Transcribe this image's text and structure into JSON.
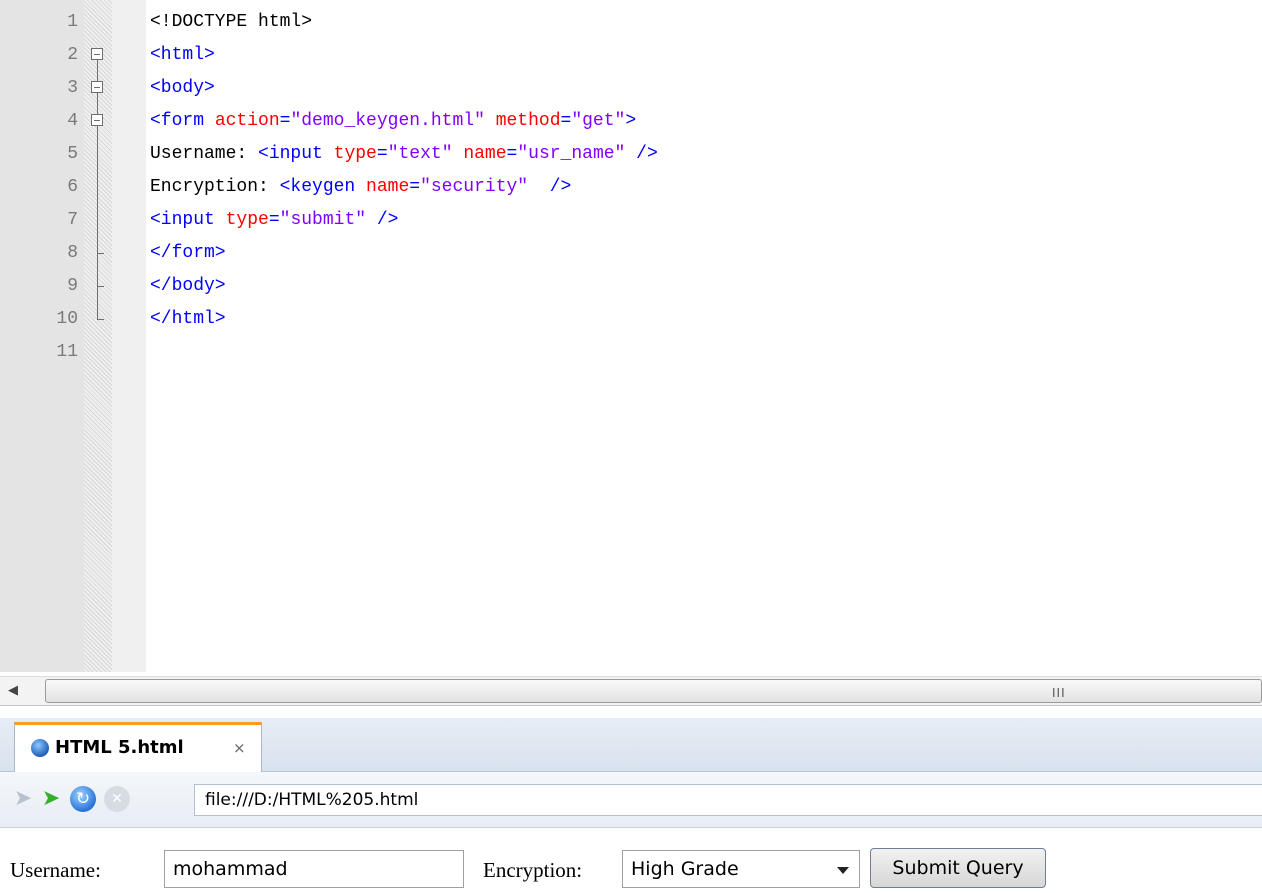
{
  "editor": {
    "lines": [
      {
        "num": "1",
        "parts": [
          {
            "t": "<!DOCTYPE html>",
            "c": "dark"
          }
        ]
      },
      {
        "num": "2",
        "parts": [
          {
            "t": "<html>",
            "c": "tag"
          }
        ]
      },
      {
        "num": "3",
        "parts": [
          {
            "t": "<body>",
            "c": "tag"
          }
        ]
      },
      {
        "num": "4",
        "parts": [
          {
            "t": "<form ",
            "c": "tag"
          },
          {
            "t": "action",
            "c": "attr"
          },
          {
            "t": "=",
            "c": "tag"
          },
          {
            "t": "\"demo_keygen.html\"",
            "c": "val"
          },
          {
            "t": " ",
            "c": "tag"
          },
          {
            "t": "method",
            "c": "attr"
          },
          {
            "t": "=",
            "c": "tag"
          },
          {
            "t": "\"get\"",
            "c": "val"
          },
          {
            "t": ">",
            "c": "tag"
          }
        ]
      },
      {
        "num": "5",
        "parts": [
          {
            "t": "Username: ",
            "c": "dark"
          },
          {
            "t": "<input ",
            "c": "tag"
          },
          {
            "t": "type",
            "c": "attr"
          },
          {
            "t": "=",
            "c": "tag"
          },
          {
            "t": "\"text\"",
            "c": "val"
          },
          {
            "t": " ",
            "c": "tag"
          },
          {
            "t": "name",
            "c": "attr"
          },
          {
            "t": "=",
            "c": "tag"
          },
          {
            "t": "\"usr_name\"",
            "c": "val"
          },
          {
            "t": " />",
            "c": "tag"
          }
        ]
      },
      {
        "num": "6",
        "parts": [
          {
            "t": "Encryption: ",
            "c": "dark"
          },
          {
            "t": "<keygen ",
            "c": "tag"
          },
          {
            "t": "name",
            "c": "attr"
          },
          {
            "t": "=",
            "c": "tag"
          },
          {
            "t": "\"security\"",
            "c": "val"
          },
          {
            "t": "  />",
            "c": "tag"
          }
        ]
      },
      {
        "num": "7",
        "parts": [
          {
            "t": "<input ",
            "c": "tag"
          },
          {
            "t": "type",
            "c": "attr"
          },
          {
            "t": "=",
            "c": "tag"
          },
          {
            "t": "\"submit\"",
            "c": "val"
          },
          {
            "t": " />",
            "c": "tag"
          }
        ]
      },
      {
        "num": "8",
        "parts": [
          {
            "t": "</form>",
            "c": "tag"
          }
        ]
      },
      {
        "num": "9",
        "parts": [
          {
            "t": "</body>",
            "c": "tag"
          }
        ]
      },
      {
        "num": "10",
        "parts": [
          {
            "t": "</html>",
            "c": "tag"
          }
        ]
      },
      {
        "num": "11",
        "parts": []
      }
    ],
    "scroll_grip": "III"
  },
  "browser": {
    "tab_title": "HTML 5.html",
    "tab_close": "×",
    "url": "file:///D:/HTML%205.html",
    "icons": [
      "back-arrow-icon",
      "forward-arrow-icon",
      "reload-icon",
      "stop-icon",
      "globe-icon"
    ]
  },
  "form": {
    "username_label": "Username:",
    "username_value": "mohammad",
    "encryption_label": "Encryption:",
    "encryption_value": "High Grade",
    "submit_label": "Submit Query"
  },
  "colors": {
    "tag": "#0000ff",
    "attribute": "#ff0000",
    "value": "#8000ff",
    "tab_accent": "#ff9a20"
  }
}
